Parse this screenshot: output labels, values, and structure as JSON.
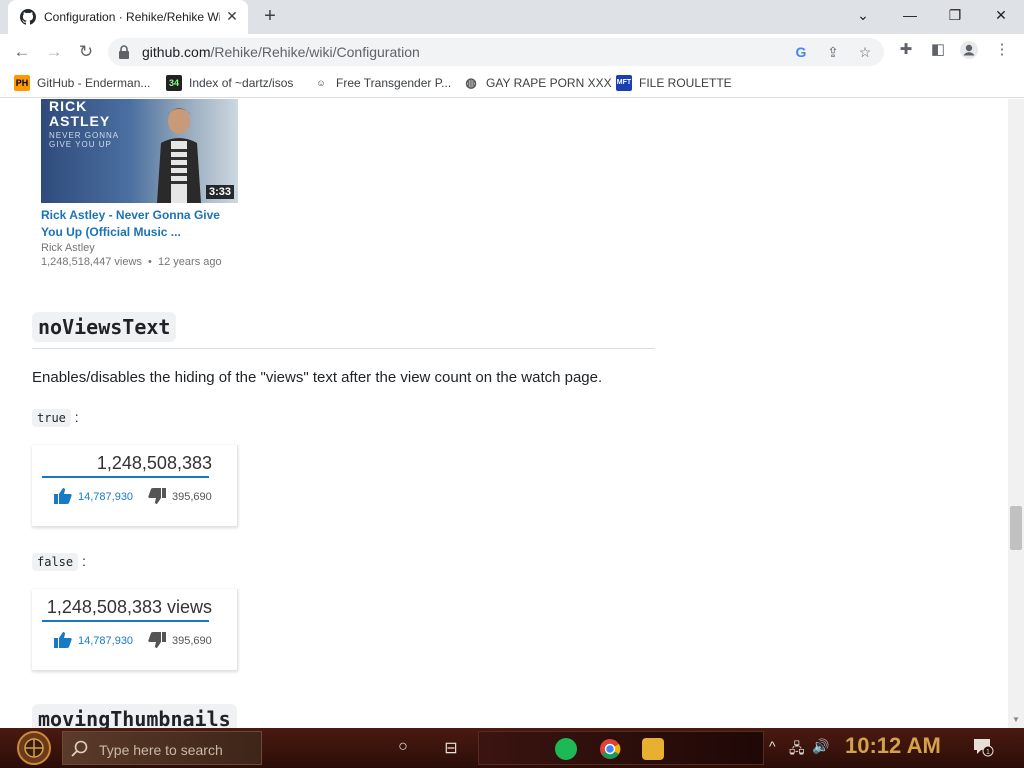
{
  "browser": {
    "tab_title": "Configuration · Rehike/Rehike Wiki",
    "url_host": "github.com",
    "url_path": "/Rehike/Rehike/wiki/Configuration",
    "bookmarks": [
      {
        "label": "GitHub - Enderman...",
        "icon": "ph-icon"
      },
      {
        "label": "Index of ~dartz/isos",
        "icon": "34-icon"
      },
      {
        "label": "Free Transgender P...",
        "icon": "mask-icon"
      },
      {
        "label": "GAY RAPE PORN XXX",
        "icon": "globe-icon"
      },
      {
        "label": "FILE ROULETTE",
        "icon": "mft-icon"
      }
    ]
  },
  "video": {
    "thumb_title": "RICK\nASTLEY",
    "thumb_subtitle": "NEVER GONNA\nGIVE YOU UP",
    "duration": "3:33",
    "title": "Rick Astley - Never Gonna Give You Up (Official Music ...",
    "channel": "Rick Astley",
    "views": "1,248,518,447 views",
    "age": "12 years ago"
  },
  "section1": {
    "heading": "noViewsText",
    "description": "Enables/disables the hiding of the \"views\" text after the view count on the watch page.",
    "true_label": "true",
    "false_label": "false",
    "separator": ":",
    "true_box": {
      "views": "1,248,508,383",
      "likes": "14,787,930",
      "dislikes": "395,690"
    },
    "false_box": {
      "views": "1,248,508,383 views",
      "likes": "14,787,930",
      "dislikes": "395,690"
    }
  },
  "section2": {
    "heading": "movingThumbnails"
  },
  "taskbar": {
    "search_placeholder": "Type here to search",
    "time": "10:12 AM",
    "notification_count": "1"
  },
  "colors": {
    "link_blue": "#1a73b8",
    "yt_blue": "#167ac6",
    "clock_gold": "#d4a24a"
  }
}
